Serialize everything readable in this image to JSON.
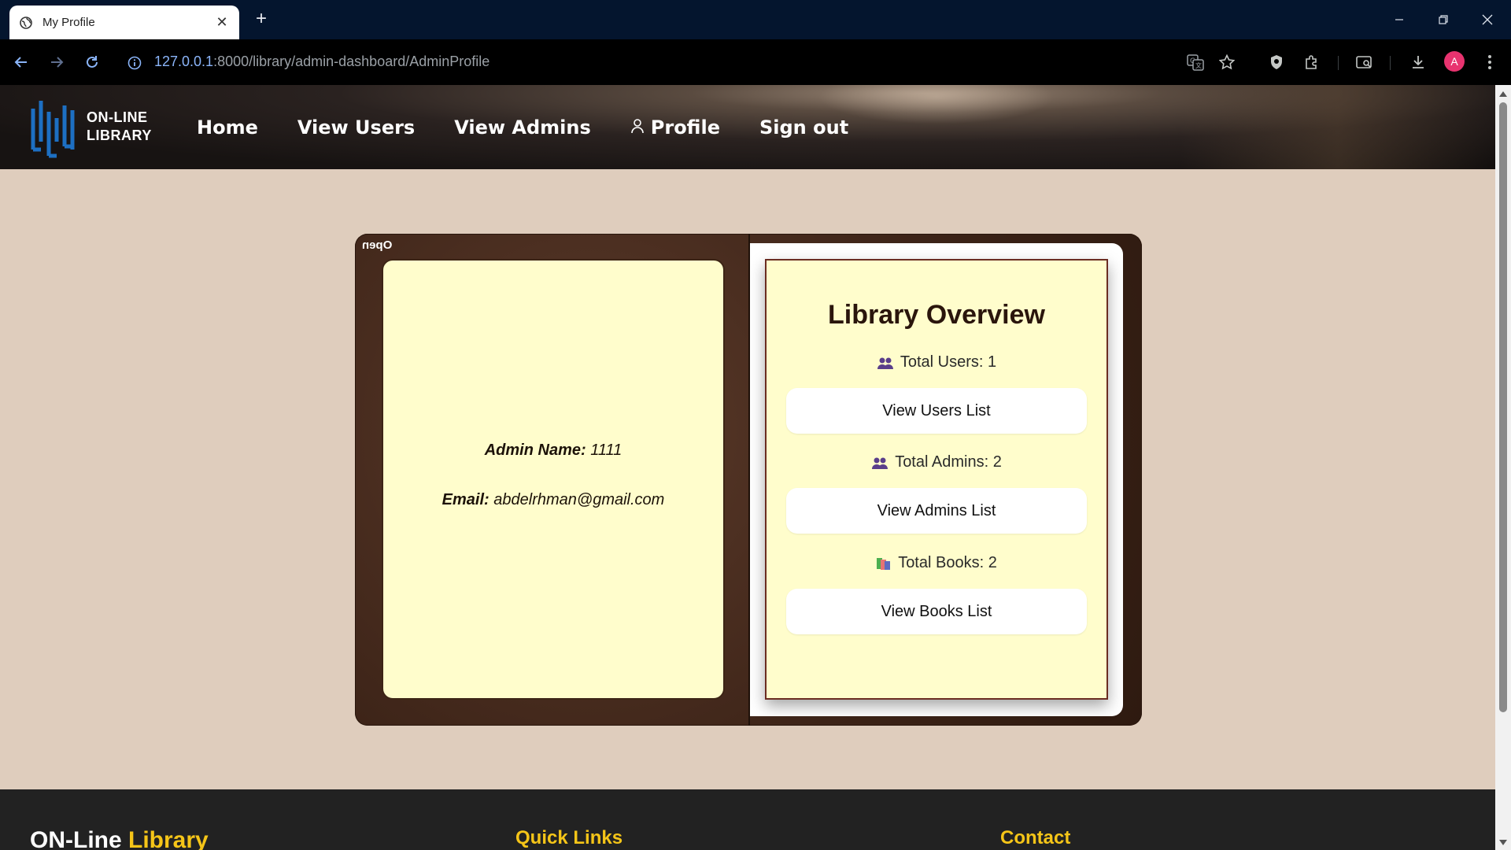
{
  "browser": {
    "tab_title": "My Profile",
    "new_tab_label": "+",
    "close_label": "✕",
    "url_host": "127.0.0.1",
    "url_path": ":8000/library/admin-dashboard/AdminProfile",
    "profile_initial": "A"
  },
  "header": {
    "logo_line1": "ON-LINE",
    "logo_line2": "LIBRARY",
    "nav": {
      "home": "Home",
      "view_users": "View Users",
      "view_admins": "View Admins",
      "profile": "Profile",
      "sign_out": "Sign out"
    }
  },
  "book": {
    "open_label": "Open",
    "profile": {
      "admin_name_label": "Admin Name:",
      "admin_name_value": "1111",
      "email_label": "Email:",
      "email_value": "abdelrhman@gmail.com"
    },
    "overview": {
      "title": "Library Overview",
      "total_users": "Total Users: 1",
      "view_users_button": "View Users List",
      "total_admins": "Total Admins: 2",
      "view_admins_button": "View Admins List",
      "total_books": "Total Books: 2",
      "view_books_button": "View Books List"
    }
  },
  "footer": {
    "brand_part1": "ON-Line ",
    "brand_part2": "Library",
    "quick_links": "Quick Links",
    "contact": "Contact"
  },
  "colors": {
    "page_bg": "#dfcdbd",
    "book_leather": "#3d2418",
    "page_paper": "#fffdcc",
    "footer_bg": "#222222",
    "footer_accent": "#f5c518",
    "logo_blue": "#1d6fc2"
  }
}
